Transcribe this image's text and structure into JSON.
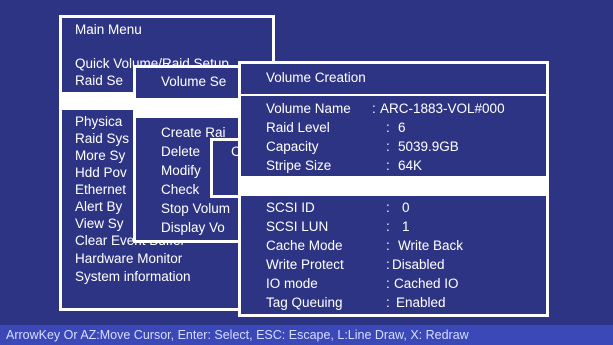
{
  "main_menu": {
    "title": "Main Menu",
    "items": [
      "Quick Volume/Raid Setup",
      "Raid Se",
      "Physica",
      "Raid Sys",
      "More Sy",
      "Hdd Pov",
      "Ethernet",
      "Alert By",
      "View Sy",
      "Clear Event Buffer",
      "Hardware Monitor",
      "System information"
    ]
  },
  "volume_set_menu": {
    "title": "Volume Se",
    "items": [
      "Create Rai",
      "Delete",
      "Modify",
      "Check",
      "Stop Volum",
      "Display Vo"
    ]
  },
  "sub_menu": {
    "partial_label": "C"
  },
  "volume_creation": {
    "title": "Volume Creation",
    "rows": [
      {
        "label": "Volume Name",
        "sep": ":",
        "value": "ARC-1883-VOL#000"
      },
      {
        "label": "Raid Level",
        "sep": ":",
        "value": "6"
      },
      {
        "label": "Capacity",
        "sep": ":",
        "value": "5039.9GB"
      },
      {
        "label": "Stripe Size",
        "sep": ":",
        "value": "64K"
      },
      {
        "label": "SCSI  ID",
        "sep": ":",
        "value": "0"
      },
      {
        "label": "SCSI  LUN",
        "sep": ":",
        "value": "1"
      },
      {
        "label": "Cache Mode",
        "sep": ":",
        "value": "Write Back"
      },
      {
        "label": "Write Protect",
        "sep": ":",
        "value": "Disabled"
      },
      {
        "label": "IO mode",
        "sep": ":",
        "value": "Cached IO"
      },
      {
        "label": "Tag Queuing",
        "sep": ":",
        "value": "Enabled"
      }
    ]
  },
  "status_bar": {
    "text": "ArrowKey Or AZ:Move Cursor, Enter: Select, ESC: Escape, L:Line Draw, X: Redraw"
  },
  "colors": {
    "background": "#2e3484",
    "border": "#ffffff",
    "highlight": "#ffffff",
    "status_bar": "#3a48b8"
  }
}
